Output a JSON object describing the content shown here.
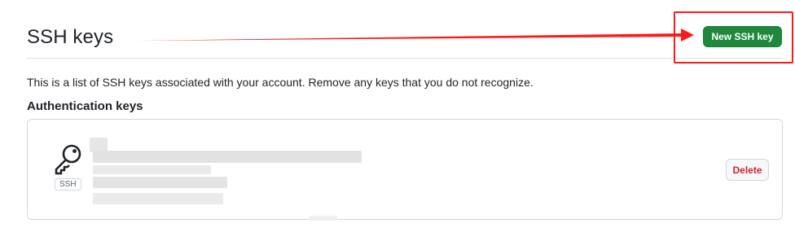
{
  "header": {
    "title": "SSH keys",
    "new_key_label": "New SSH key"
  },
  "description": "This is a list of SSH keys associated with your account. Remove any keys that you do not recognize.",
  "section": {
    "heading": "Authentication keys"
  },
  "key": {
    "type_badge": "SSH",
    "icon": "key-icon",
    "delete_label": "Delete"
  },
  "annotation": {
    "color": "#ff1a1a"
  },
  "colors": {
    "primary_button": "#1f883d",
    "danger_text": "#d1242f",
    "border": "#d0d7de"
  }
}
